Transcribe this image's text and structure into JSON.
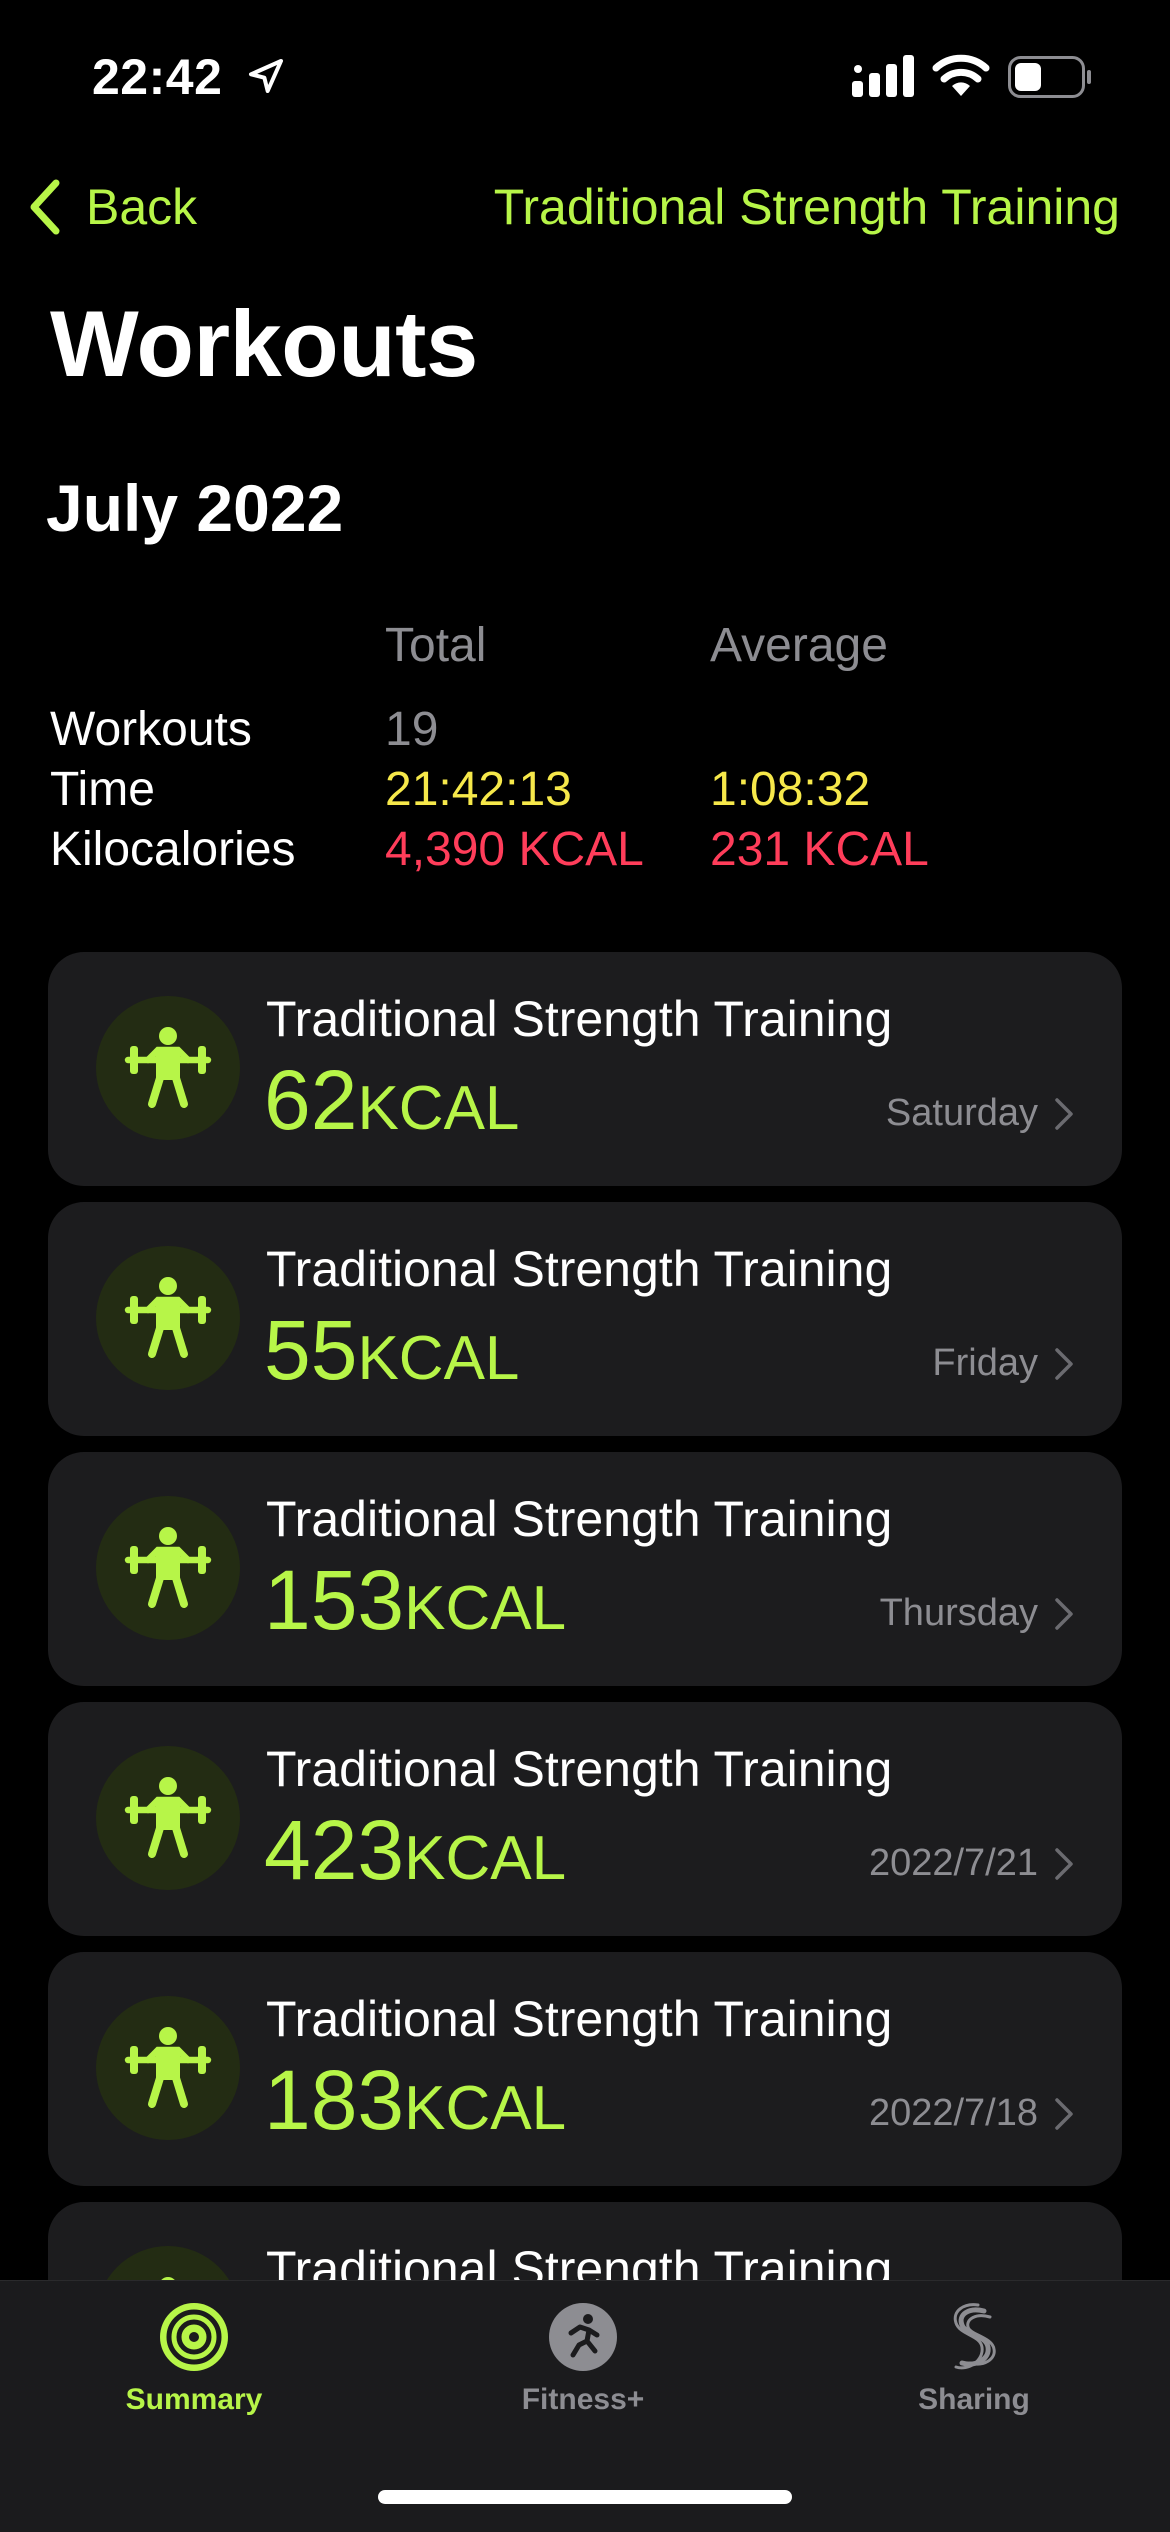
{
  "status_bar": {
    "time": "22:42"
  },
  "nav": {
    "back_label": "Back",
    "title": "Traditional Strength Training"
  },
  "page": {
    "title": "Workouts",
    "month": "July 2022"
  },
  "summary": {
    "col_total": "Total",
    "col_average": "Average",
    "rows": [
      {
        "label": "Workouts",
        "total": "19",
        "average": ""
      },
      {
        "label": "Time",
        "total": "21:42:13",
        "average": "1:08:32"
      },
      {
        "label": "Kilocalories",
        "total": "4,390 KCAL",
        "average": "231 KCAL"
      }
    ]
  },
  "workouts": [
    {
      "title": "Traditional Strength Training",
      "kcal": "62",
      "unit": "KCAL",
      "date": "Saturday"
    },
    {
      "title": "Traditional Strength Training",
      "kcal": "55",
      "unit": "KCAL",
      "date": "Friday"
    },
    {
      "title": "Traditional Strength Training",
      "kcal": "153",
      "unit": "KCAL",
      "date": "Thursday"
    },
    {
      "title": "Traditional Strength Training",
      "kcal": "423",
      "unit": "KCAL",
      "date": "2022/7/21"
    },
    {
      "title": "Traditional Strength Training",
      "kcal": "183",
      "unit": "KCAL",
      "date": "2022/7/18"
    },
    {
      "title": "Traditional Strength Training",
      "kcal": "",
      "unit": "",
      "date": ""
    }
  ],
  "tabs": [
    {
      "label": "Summary",
      "icon": "activity-rings-icon",
      "active": true
    },
    {
      "label": "Fitness+",
      "icon": "running-figure-icon",
      "active": false
    },
    {
      "label": "Sharing",
      "icon": "sharing-icon",
      "active": false
    }
  ],
  "colors": {
    "accent": "#b7f548",
    "time": "#f6e84a",
    "kcal": "#ff3d5a",
    "secondary": "#8d8d92",
    "card_bg": "#1c1c1e"
  }
}
